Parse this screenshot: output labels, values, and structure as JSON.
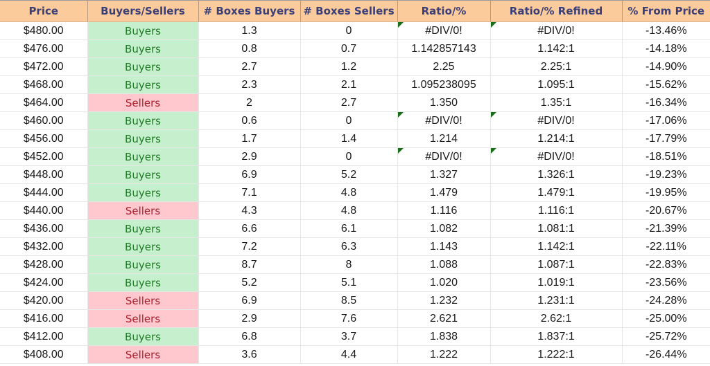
{
  "headers": [
    "Price",
    "Buyers/Sellers",
    "# Boxes Buyers",
    "# Boxes Sellers",
    "Ratio/%",
    "Ratio/% Refined",
    "% From Price"
  ],
  "colors": {
    "header_bg": "#fccb9c",
    "header_text": "#3b3f78",
    "buyers_bg": "#c6efce",
    "buyers_text": "#1e7b24",
    "sellers_bg": "#ffc7ce",
    "sellers_text": "#a8202b",
    "error_flag": "#1a6e1a"
  },
  "rows": [
    {
      "price": "$480.00",
      "side": "Buyers",
      "boxes_buyers": "1.3",
      "boxes_sellers": "0",
      "ratio": "#DIV/0!",
      "refined": "#DIV/0!",
      "from_price": "-13.46%",
      "error": true
    },
    {
      "price": "$476.00",
      "side": "Buyers",
      "boxes_buyers": "0.8",
      "boxes_sellers": "0.7",
      "ratio": "1.142857143",
      "refined": "1.142:1",
      "from_price": "-14.18%",
      "error": false
    },
    {
      "price": "$472.00",
      "side": "Buyers",
      "boxes_buyers": "2.7",
      "boxes_sellers": "1.2",
      "ratio": "2.25",
      "refined": "2.25:1",
      "from_price": "-14.90%",
      "error": false
    },
    {
      "price": "$468.00",
      "side": "Buyers",
      "boxes_buyers": "2.3",
      "boxes_sellers": "2.1",
      "ratio": "1.095238095",
      "refined": "1.095:1",
      "from_price": "-15.62%",
      "error": false
    },
    {
      "price": "$464.00",
      "side": "Sellers",
      "boxes_buyers": "2",
      "boxes_sellers": "2.7",
      "ratio": "1.350",
      "refined": "1.35:1",
      "from_price": "-16.34%",
      "error": false
    },
    {
      "price": "$460.00",
      "side": "Buyers",
      "boxes_buyers": "0.6",
      "boxes_sellers": "0",
      "ratio": "#DIV/0!",
      "refined": "#DIV/0!",
      "from_price": "-17.06%",
      "error": true
    },
    {
      "price": "$456.00",
      "side": "Buyers",
      "boxes_buyers": "1.7",
      "boxes_sellers": "1.4",
      "ratio": "1.214",
      "refined": "1.214:1",
      "from_price": "-17.79%",
      "error": false
    },
    {
      "price": "$452.00",
      "side": "Buyers",
      "boxes_buyers": "2.9",
      "boxes_sellers": "0",
      "ratio": "#DIV/0!",
      "refined": "#DIV/0!",
      "from_price": "-18.51%",
      "error": true
    },
    {
      "price": "$448.00",
      "side": "Buyers",
      "boxes_buyers": "6.9",
      "boxes_sellers": "5.2",
      "ratio": "1.327",
      "refined": "1.326:1",
      "from_price": "-19.23%",
      "error": false
    },
    {
      "price": "$444.00",
      "side": "Buyers",
      "boxes_buyers": "7.1",
      "boxes_sellers": "4.8",
      "ratio": "1.479",
      "refined": "1.479:1",
      "from_price": "-19.95%",
      "error": false
    },
    {
      "price": "$440.00",
      "side": "Sellers",
      "boxes_buyers": "4.3",
      "boxes_sellers": "4.8",
      "ratio": "1.116",
      "refined": "1.116:1",
      "from_price": "-20.67%",
      "error": false
    },
    {
      "price": "$436.00",
      "side": "Buyers",
      "boxes_buyers": "6.6",
      "boxes_sellers": "6.1",
      "ratio": "1.082",
      "refined": "1.081:1",
      "from_price": "-21.39%",
      "error": false
    },
    {
      "price": "$432.00",
      "side": "Buyers",
      "boxes_buyers": "7.2",
      "boxes_sellers": "6.3",
      "ratio": "1.143",
      "refined": "1.142:1",
      "from_price": "-22.11%",
      "error": false
    },
    {
      "price": "$428.00",
      "side": "Buyers",
      "boxes_buyers": "8.7",
      "boxes_sellers": "8",
      "ratio": "1.088",
      "refined": "1.087:1",
      "from_price": "-22.83%",
      "error": false
    },
    {
      "price": "$424.00",
      "side": "Buyers",
      "boxes_buyers": "5.2",
      "boxes_sellers": "5.1",
      "ratio": "1.020",
      "refined": "1.019:1",
      "from_price": "-23.56%",
      "error": false
    },
    {
      "price": "$420.00",
      "side": "Sellers",
      "boxes_buyers": "6.9",
      "boxes_sellers": "8.5",
      "ratio": "1.232",
      "refined": "1.231:1",
      "from_price": "-24.28%",
      "error": false
    },
    {
      "price": "$416.00",
      "side": "Sellers",
      "boxes_buyers": "2.9",
      "boxes_sellers": "7.6",
      "ratio": "2.621",
      "refined": "2.62:1",
      "from_price": "-25.00%",
      "error": false
    },
    {
      "price": "$412.00",
      "side": "Buyers",
      "boxes_buyers": "6.8",
      "boxes_sellers": "3.7",
      "ratio": "1.838",
      "refined": "1.837:1",
      "from_price": "-25.72%",
      "error": false
    },
    {
      "price": "$408.00",
      "side": "Sellers",
      "boxes_buyers": "3.6",
      "boxes_sellers": "4.4",
      "ratio": "1.222",
      "refined": "1.222:1",
      "from_price": "-26.44%",
      "error": false
    }
  ]
}
